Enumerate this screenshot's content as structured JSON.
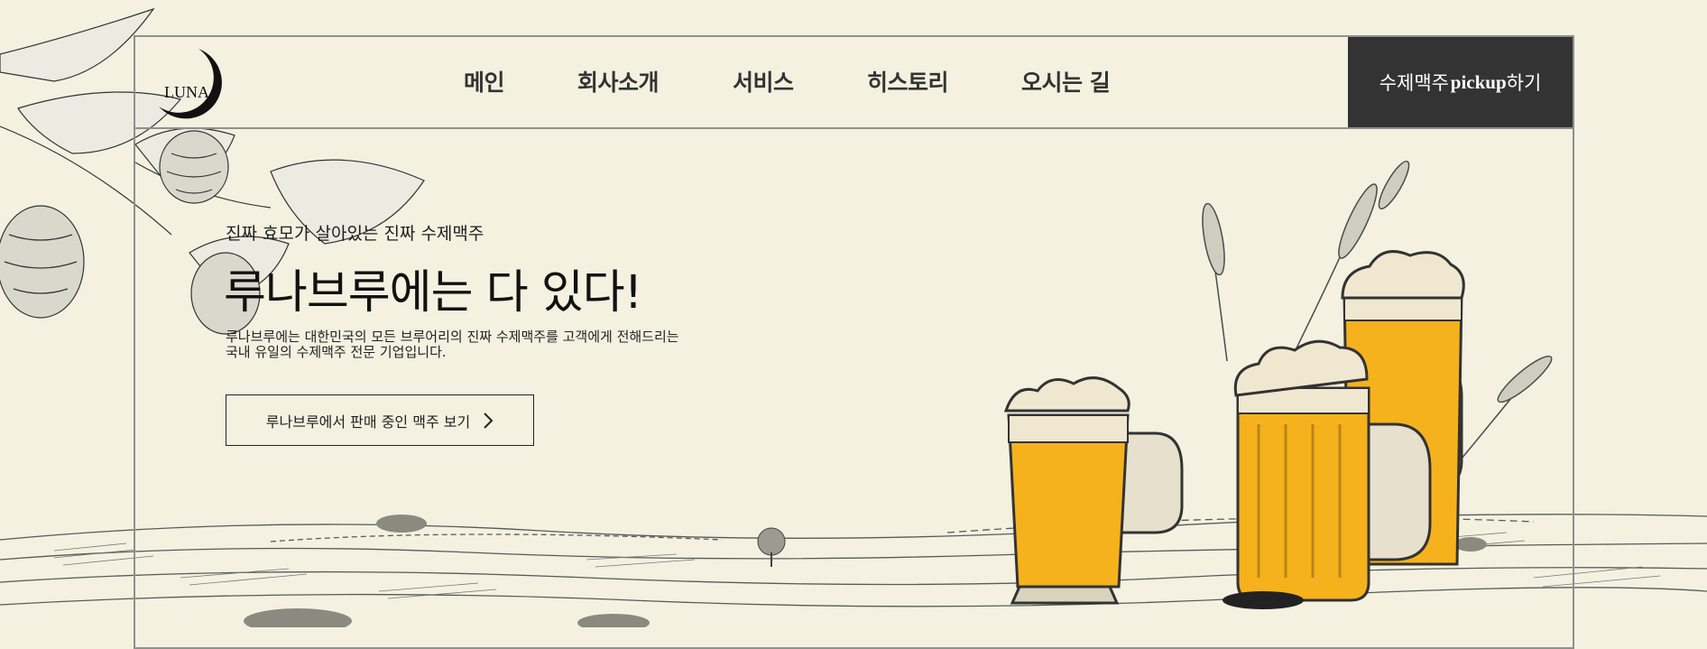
{
  "brand": {
    "logo_text": "LUNA"
  },
  "nav": {
    "items": [
      "메인",
      "회사소개",
      "서비스",
      "히스토리",
      "오시는 길"
    ]
  },
  "pickup": {
    "prefix": "수제맥주 ",
    "bold": "pickup",
    "suffix": "하기"
  },
  "hero": {
    "subtitle": "진짜 효모가 살아있는 진짜 수제맥주",
    "title": "루나브루에는 다 있다!",
    "desc_line1": "루나브루에는 대한민국의 모든 브루어리의 진짜 수제맥주를 고객에게 전해드리는",
    "desc_line2": "국내 유일의 수제맥주 전문 기업입니다.",
    "cta_label": "루나브루에서 판매 중인 맥주 보기"
  },
  "colors": {
    "background": "#f4f1e1",
    "dark": "#333333",
    "beer": "#f6b21c",
    "foam": "#efe7cf"
  },
  "icons": [
    "hop-leaf-illustration",
    "wheat-illustration",
    "beer-glass-illustration",
    "chevron-right-icon",
    "moon-logo"
  ]
}
